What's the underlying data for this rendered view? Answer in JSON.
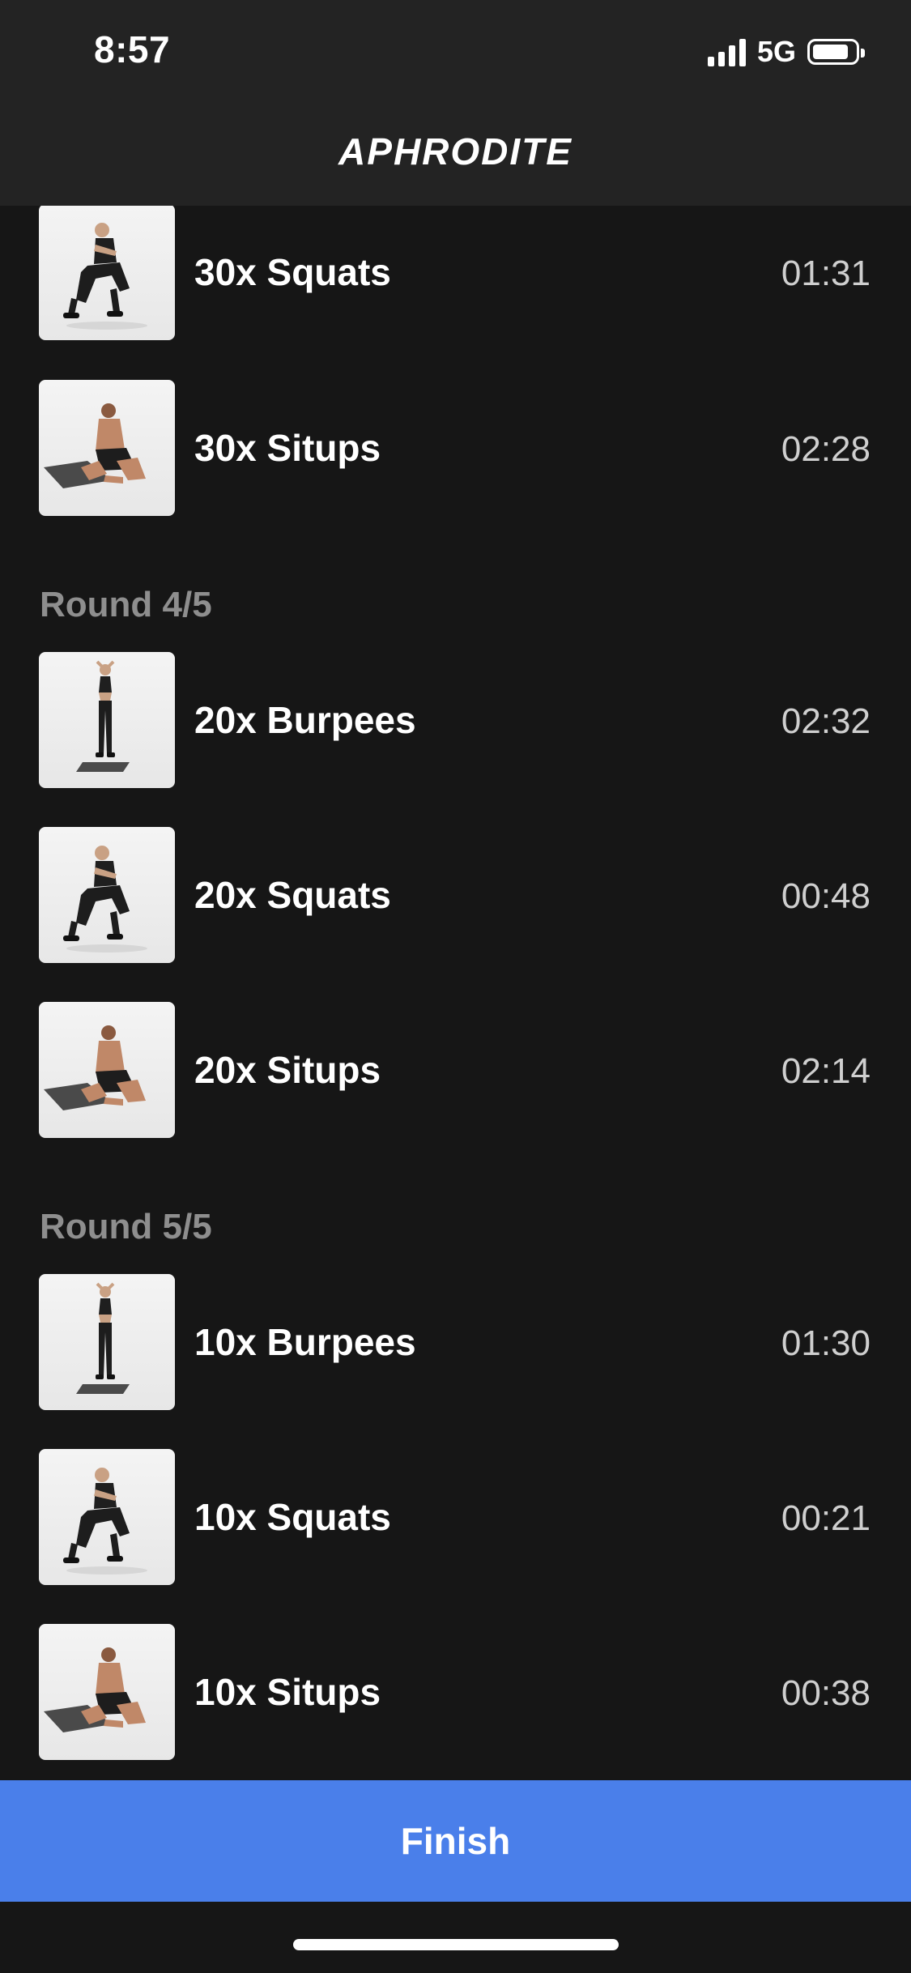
{
  "status_bar": {
    "time": "8:57",
    "network": "5G",
    "battery_level": 0.85
  },
  "header": {
    "title": "APHRODITE"
  },
  "rounds": [
    {
      "label": "",
      "exercises": [
        {
          "name": "30x Squats",
          "time": "01:31",
          "pose": "squat"
        },
        {
          "name": "30x Situps",
          "time": "02:28",
          "pose": "situp"
        }
      ]
    },
    {
      "label": "Round 4/5",
      "exercises": [
        {
          "name": "20x Burpees",
          "time": "02:32",
          "pose": "burpee"
        },
        {
          "name": "20x Squats",
          "time": "00:48",
          "pose": "squat"
        },
        {
          "name": "20x Situps",
          "time": "02:14",
          "pose": "situp"
        }
      ]
    },
    {
      "label": "Round 5/5",
      "exercises": [
        {
          "name": "10x Burpees",
          "time": "01:30",
          "pose": "burpee"
        },
        {
          "name": "10x Squats",
          "time": "00:21",
          "pose": "squat"
        },
        {
          "name": "10x Situps",
          "time": "00:38",
          "pose": "situp"
        }
      ]
    }
  ],
  "footer": {
    "finish_label": "Finish"
  },
  "colors": {
    "background": "#161616",
    "header": "#232323",
    "accent": "#4a7fea",
    "muted_text": "#8e8e8e"
  }
}
